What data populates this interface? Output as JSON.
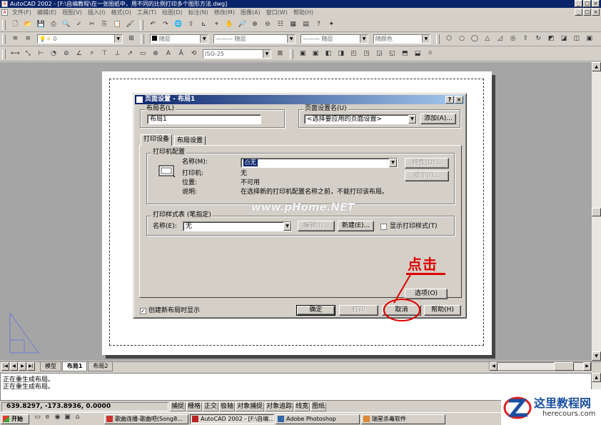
{
  "window": {
    "title": "AutoCAD 2002 - [F:\\自编教程\\在一张图纸中，用不同的比例打印多个图形方法.dwg]"
  },
  "menubar": [
    "文件(F)",
    "编辑(E)",
    "视图(V)",
    "插入(I)",
    "格式(O)",
    "工具(T)",
    "绘图(D)",
    "标注(N)",
    "修改(M)",
    "图像(A)",
    "窗口(W)",
    "帮助(H)"
  ],
  "toolbar": {
    "layer_value": "0",
    "color_value": "随层",
    "linetype_value": "随层",
    "lineweight_value": "随层",
    "plotstyle_value": "随颜色",
    "dimstyle_value": "ISO-25"
  },
  "dialog": {
    "title": "页面设置 - 布局1",
    "layout_name_label": "布局名(L)",
    "layout_name_value": "布局1",
    "page_setup_label": "页面设置名(U)",
    "page_setup_value": "<选择要应用的页面设置>",
    "add_button": "添加(A)...",
    "tabs": [
      "打印设备",
      "布局设置"
    ],
    "plotter_group": "打印机配置",
    "name_label": "名称(M):",
    "name_value": "无",
    "properties_button": "特性(O)...",
    "hints_button": "提示(I)...",
    "plotter_label": "打印机:",
    "plotter_value": "无",
    "location_label": "位置:",
    "location_value": "不可用",
    "description_label": "说明:",
    "description_value": "在选择新的打印机配置名称之前，不能打印该布局。",
    "plotstyle_group": "打印样式表 (笔指定)",
    "plotstyle_name_label": "名称(E):",
    "plotstyle_name_value": "无",
    "edit_button": "编辑(I)...",
    "new_button": "新建(E)...",
    "show_plotstyles_label": "显示打印样式(T)",
    "options_button": "选项(O)",
    "show_on_create_label": "创建新布局时显示",
    "ok_button": "确定",
    "plot_button": "打印",
    "cancel_button": "取消",
    "help_button": "帮助(H)"
  },
  "annotation": {
    "text": "点击",
    "color": "#e00000"
  },
  "watermark": "www.pHome.NET",
  "layout_tabs": [
    "模型",
    "布局1",
    "布局2"
  ],
  "command_lines": [
    "正在重生成布局。",
    "正在重生成布局。"
  ],
  "status": {
    "coords": "639.8297, -173.8936, 0.0000",
    "modes": [
      "捕捉",
      "栅格",
      "正交",
      "极轴",
      "对象捕捉",
      "对象追踪",
      "线宽",
      "图纸"
    ]
  },
  "taskbar": {
    "start": "开始",
    "items": [
      "歌曲连播-歌曲吧(Song8...",
      "AutoCAD 2002 - [F:\\自编...",
      "Adobe Photoshop",
      "瑞星杀毒软件"
    ]
  },
  "logo": {
    "name": "这里教程网",
    "url": "herecours.com"
  }
}
